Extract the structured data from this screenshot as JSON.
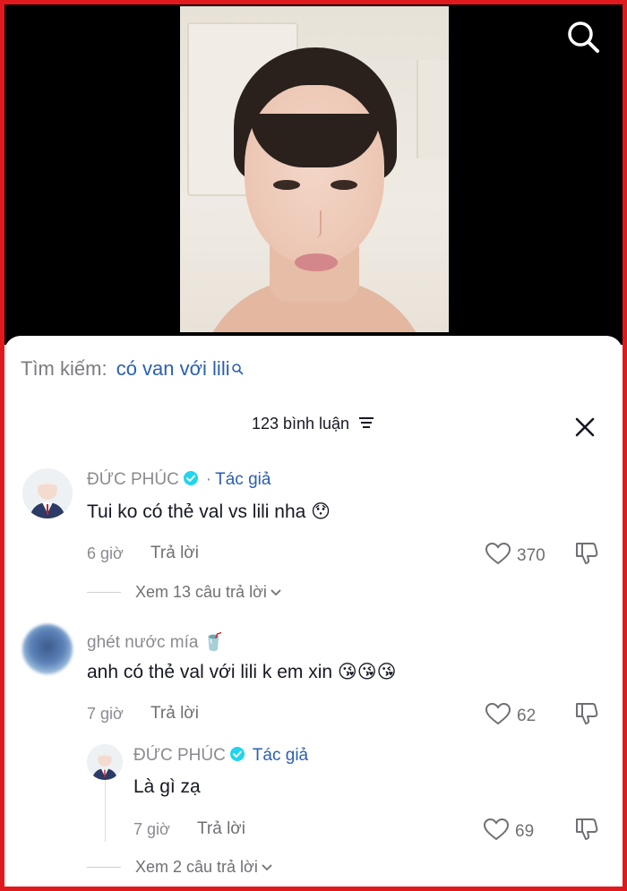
{
  "search": {
    "label": "Tìm kiếm:",
    "query": "có van với lili"
  },
  "header": {
    "comment_count": "123 bình luận"
  },
  "comments": [
    {
      "username": "ĐỨC PHÚC",
      "verified": true,
      "author_dot": "·",
      "author_tag": "Tác giả",
      "text": "Tui ko có thẻ val vs lili nha 😯",
      "time": "6 giờ",
      "reply_label": "Trả lời",
      "likes": "370",
      "view_replies": "Xem 13 câu trả lời"
    },
    {
      "username": "ghét nước mía 🥤",
      "verified": false,
      "text": "anh có thẻ val với lili k em xin 😘😘😘",
      "time": "7 giờ",
      "reply_label": "Trả lời",
      "likes": "62",
      "reply": {
        "username": "ĐỨC PHÚC",
        "verified": true,
        "author_tag": "Tác giả",
        "text": "Là gì zạ",
        "time": "7 giờ",
        "reply_label": "Trả lời",
        "likes": "69"
      },
      "view_replies": "Xem 2 câu trả lời"
    }
  ],
  "icons": {
    "search": "search-icon",
    "sort": "sort-icon",
    "close": "close-icon",
    "verified": "verified-badge-icon",
    "like": "heart-icon",
    "dislike": "dislike-icon",
    "expand": "chevron-down-icon"
  },
  "colors": {
    "frame_border": "#e0191d",
    "link_blue": "#2a5fb0",
    "verified_cyan": "#20d5ec"
  }
}
